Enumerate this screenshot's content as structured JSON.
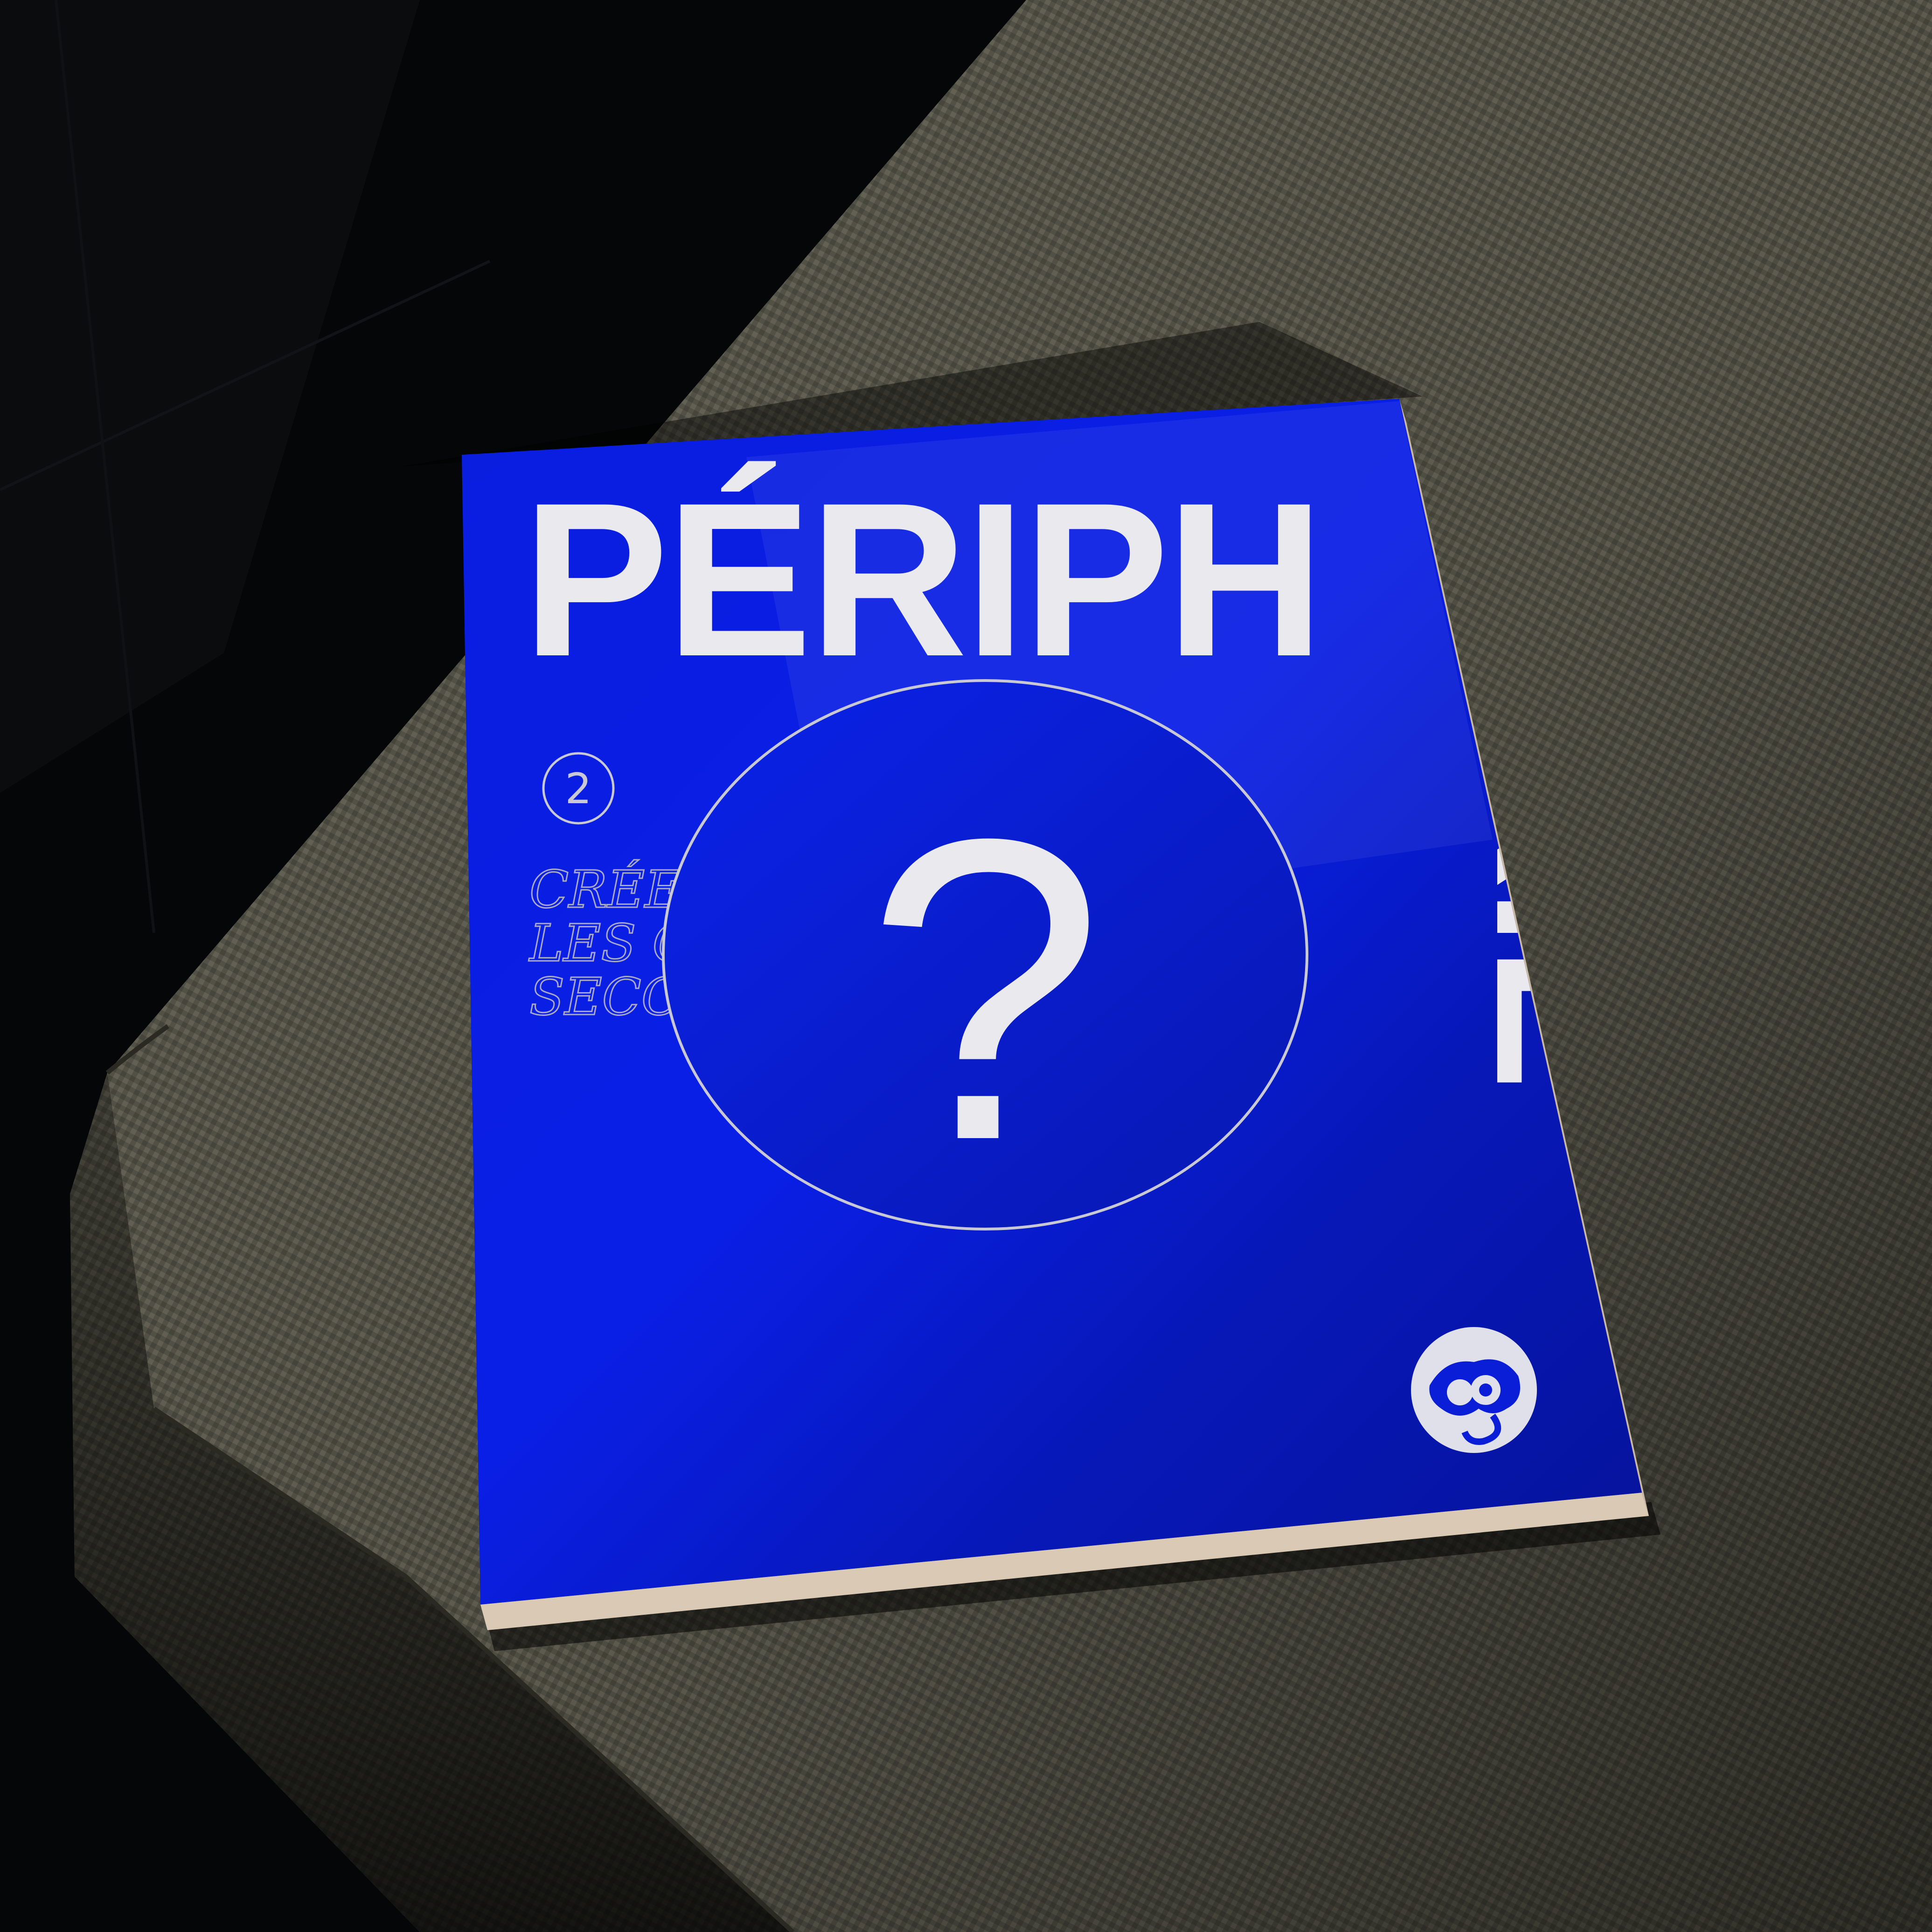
{
  "scene": {
    "description_colors": {
      "background": "#050607",
      "fabric": "#5f5d50",
      "fabric_dark": "#3a3930",
      "cover_blue": "#0a1ed8",
      "cover_blue_dark": "#06129a",
      "ink": "#e9e9ee"
    }
  },
  "magazine": {
    "title_top": "PÉRIP",
    "title_overlap_letter": "H",
    "title_side": "ÉRIE",
    "issue_number": "2",
    "subtitle_lines": [
      "CRÉE",
      "LES C",
      "SECO"
    ],
    "center_glyph": "?",
    "logo_icon": "binoculars-hand-icon"
  }
}
